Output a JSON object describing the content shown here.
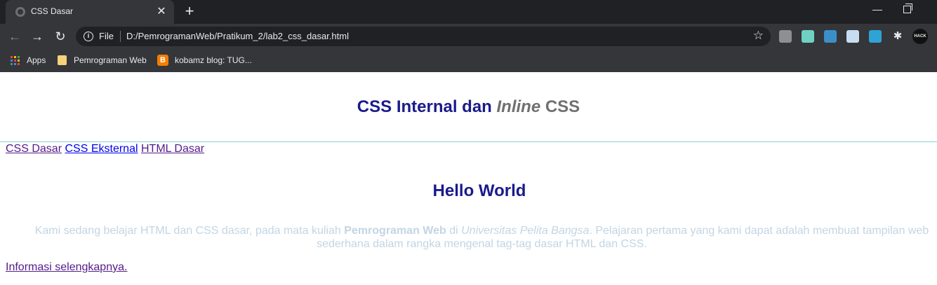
{
  "browser": {
    "tab": {
      "title": "CSS Dasar",
      "close": "✕"
    },
    "new_tab": "+",
    "window": {
      "minimize": "—"
    },
    "nav": {
      "back": "←",
      "forward": "→",
      "reload": "↻"
    },
    "omnibox": {
      "info": "i",
      "scheme": "File",
      "url": "D:/PemrogramanWeb/Pratikum_2/lab2_css_dasar.html",
      "star": "☆"
    },
    "extensions": {
      "puzzle": "✱",
      "profile": "HACK PACK"
    },
    "bookmarks": {
      "apps": "Apps",
      "folder": "Pemrograman Web",
      "blog": "kobamz blog: TUG..."
    },
    "apps_colors": [
      "#ea4335",
      "#fbbc05",
      "#34a853",
      "#4285f4",
      "#ea4335",
      "#fbbc05",
      "#34a853",
      "#4285f4",
      "#ea4335"
    ]
  },
  "page": {
    "header": {
      "part1": "CSS Internal dan ",
      "part2": "Inline",
      "part3": " CSS"
    },
    "nav_links": [
      {
        "label": "CSS Dasar",
        "state": "visited"
      },
      {
        "label": "CSS Eksternal",
        "state": "unvisited"
      },
      {
        "label": "HTML Dasar",
        "state": "visited"
      }
    ],
    "hello": "Hello World",
    "paragraph": {
      "t1": "Kami sedang belajar HTML dan CSS dasar, pada mata kuliah ",
      "b1": "Pemrograman Web",
      "t2": " di ",
      "i1": "Universitas Pelita Bangsa",
      "t3": ". Pelajaran pertama yang kami dapat adalah membuat tampilan web sederhana dalam rangka mengenal tag-tag dasar HTML dan CSS."
    },
    "more_link": "Informasi selengkapnya."
  },
  "colors": {
    "chrome_dark": "#202124",
    "chrome_mid": "#35363a",
    "heading_blue": "#1a1a8c",
    "heading_gray": "#707070",
    "paragraph": "#c2d5e4",
    "rule": "#7fd3d3",
    "link_visited": "#551a8b",
    "link_unvisited": "#0000ee"
  }
}
